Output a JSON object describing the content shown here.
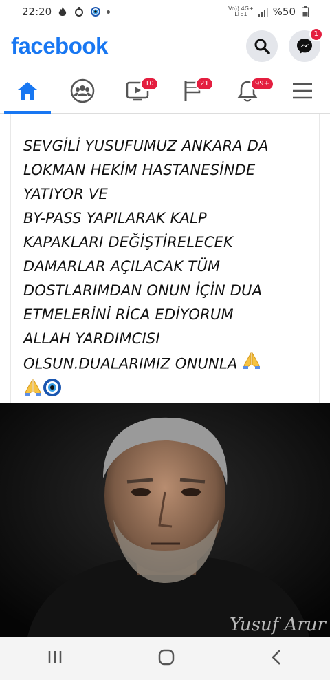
{
  "status_bar": {
    "time": "22:20",
    "network_top": "Vo)) 4G+",
    "network_bottom": "LTE1",
    "battery": "%50",
    "icons": [
      "flame-icon",
      "notification-icon",
      "evil-eye-icon",
      "dot-icon",
      "signal-icon",
      "battery-icon"
    ]
  },
  "header": {
    "brand": "facebook",
    "brand_color": "#1877f2",
    "messenger_badge": "1"
  },
  "tabs": [
    {
      "name": "home",
      "icon": "home-icon",
      "active": true,
      "badge": ""
    },
    {
      "name": "groups",
      "icon": "groups-icon",
      "active": false,
      "badge": ""
    },
    {
      "name": "watch",
      "icon": "video-icon",
      "active": false,
      "badge": "10"
    },
    {
      "name": "pages",
      "icon": "flag-icon",
      "active": false,
      "badge": "21"
    },
    {
      "name": "notifications",
      "icon": "bell-icon",
      "active": false,
      "badge": "99+"
    },
    {
      "name": "menu",
      "icon": "menu-icon",
      "active": false,
      "badge": ""
    }
  ],
  "post": {
    "text": "SEVGİLİ YUSUFUMUZ ANKARA DA\nLOKMAN HEKİM HASTANESİNDE\nYATIYOR VE\nBY-PASS YAPILARAK KALP\nKAPAKLARI DEĞİŞTİRELECEK\nDAMARLAR AÇILACAK  TÜM\nDOSTLARIMDAN ONUN İÇİN DUA\nETMELERİNİ RİCA EDİYORUM\nALLAH YARDIMCISI\nOLSUN.DUALARIMIZ ONUNLA",
    "emojis": [
      "praying-hands-icon",
      "praying-hands-icon",
      "evil-eye-icon"
    ]
  },
  "photo": {
    "signature": "Yusuf Arur"
  },
  "navbar": {
    "items": [
      "recent-apps-icon",
      "home-circle-icon",
      "back-icon"
    ]
  }
}
